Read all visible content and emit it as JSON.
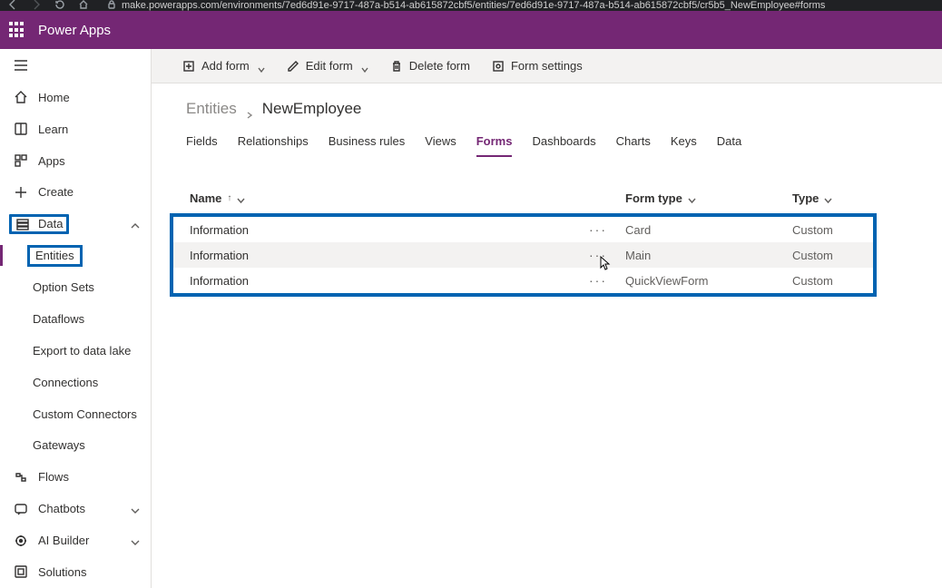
{
  "browser": {
    "url": "make.powerapps.com/environments/7ed6d91e-9717-487a-b514-ab615872cbf5/entities/7ed6d91e-9717-487a-b514-ab615872cbf5/cr5b5_NewEmployee#forms"
  },
  "suite": {
    "app_name": "Power Apps"
  },
  "sidebar": {
    "items": {
      "home": "Home",
      "learn": "Learn",
      "apps": "Apps",
      "create": "Create",
      "data": "Data",
      "flows": "Flows",
      "chatbots": "Chatbots",
      "ai_builder": "AI Builder",
      "solutions": "Solutions"
    },
    "data_sub": {
      "entities": "Entities",
      "option_sets": "Option Sets",
      "dataflows": "Dataflows",
      "export": "Export to data lake",
      "connections": "Connections",
      "custom_conn": "Custom Connectors",
      "gateways": "Gateways"
    }
  },
  "toolbar": {
    "add_form": "Add form",
    "edit_form": "Edit form",
    "delete_form": "Delete form",
    "form_settings": "Form settings"
  },
  "breadcrumb": {
    "root": "Entities",
    "current": "NewEmployee"
  },
  "tabs": {
    "fields": "Fields",
    "relationships": "Relationships",
    "business_rules": "Business rules",
    "views": "Views",
    "forms": "Forms",
    "dashboards": "Dashboards",
    "charts": "Charts",
    "keys": "Keys",
    "data": "Data"
  },
  "table": {
    "headers": {
      "name": "Name",
      "form_type": "Form type",
      "type": "Type"
    },
    "rows": [
      {
        "name": "Information",
        "form_type": "Card",
        "type": "Custom"
      },
      {
        "name": "Information",
        "form_type": "Main",
        "type": "Custom"
      },
      {
        "name": "Information",
        "form_type": "QuickViewForm",
        "type": "Custom"
      }
    ]
  }
}
